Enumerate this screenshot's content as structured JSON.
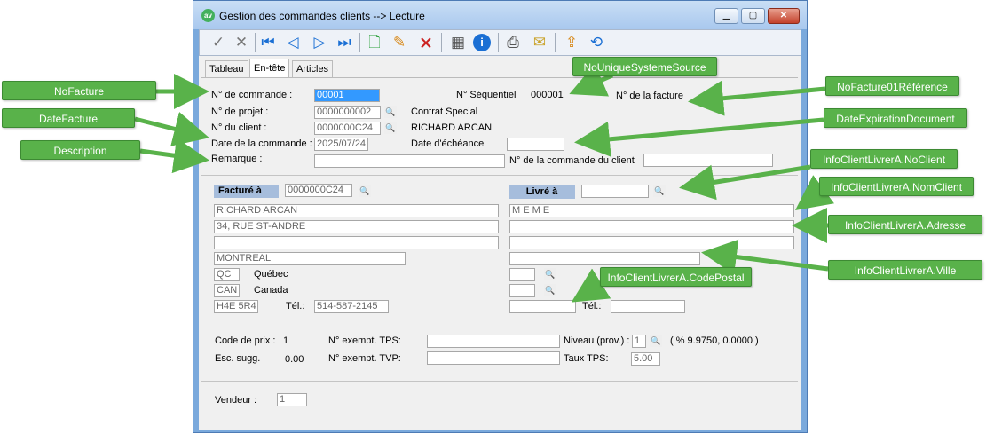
{
  "window": {
    "title": "Gestion des commandes clients  --> Lecture",
    "icon_text": "av",
    "min_label": "▁",
    "max_label": "▢",
    "close_label": "✕"
  },
  "toolbar": {
    "icons": [
      "check-icon",
      "cancel-icon",
      "first-record-icon",
      "previous-record-icon",
      "next-record-icon",
      "last-record-icon",
      "add-document-icon",
      "edit-icon",
      "delete-document-icon",
      "hardware-icon",
      "info-icon",
      "print-icon",
      "email-icon",
      "export-icon",
      "refresh-icon"
    ]
  },
  "tabs": [
    "Tableau",
    "En-tête",
    "Articles"
  ],
  "header": {
    "no_commande_label": "N° de commande :",
    "no_commande_value": "00001",
    "no_projet_label": "N° de projet :",
    "no_projet_value": "0000000002",
    "projet_desc": "Contrat Special",
    "no_client_label": "N° du client :",
    "no_client_value": "0000000C24",
    "client_name": "RICHARD ARCAN",
    "date_commande_label": "Date de la commande :",
    "date_commande_value": "2025/07/24",
    "remarque_label": "Remarque :",
    "remarque_value": "",
    "sequentiel_label": "N° Séquentiel",
    "sequentiel_value": "000001",
    "facture_label": "N° de la facture",
    "echeance_label": "Date d'échéance",
    "echeance_value": "",
    "commande_client_label": "N° de la commande du client",
    "commande_client_value": ""
  },
  "billing": {
    "title": "Facturé à",
    "client_no": "0000000C24",
    "name": "RICHARD ARCAN",
    "address1": "34, RUE ST-ANDRE",
    "address2": "",
    "city": "MONTREAL",
    "province_code": "QC",
    "province_name": "Québec",
    "country_code": "CAN",
    "country_name": "Canada",
    "postal_code": "H4E 5R4",
    "phone_label": "Tél.:",
    "phone": "514-587-2145"
  },
  "shipping": {
    "title": "Livré à",
    "client_no": "",
    "name": "M E M E",
    "address1": "",
    "address2": "",
    "city": "",
    "province_code": "",
    "country_code": "",
    "postal_code": "",
    "phone_label": "Tél.:",
    "phone": ""
  },
  "pricing": {
    "code_prix_label": "Code de prix :",
    "code_prix_value": "1",
    "esc_label": "Esc. sugg.",
    "esc_value": "0.00",
    "tps_label": "N° exempt. TPS:",
    "tvp_label": "N° exempt. TVP:",
    "niveau_label": "Niveau (prov.) :",
    "niveau_value": "1",
    "rates_text": "( %  9.9750,   0.0000 )",
    "taux_tps_label": "Taux TPS:",
    "taux_tps_value": "5.00"
  },
  "vendeur": {
    "label": "Vendeur :",
    "value": "1"
  },
  "callouts": {
    "nofacture": "NoFacture",
    "datefacture": "DateFacture",
    "description": "Description",
    "nounique": "NoUniqueSystemeSource",
    "nofacture01": "NoFacture01Référence",
    "dateexpiration": "DateExpirationDocument",
    "noclient": "InfoClientLivrerA.NoClient",
    "nomclient": "InfoClientLivrerA.NomClient",
    "adresse": "InfoClientLivrerA.Adresse",
    "ville": "InfoClientLivrerA.Ville",
    "codepostal": "InfoClientLivrerA.CodePostal"
  },
  "colors": {
    "callout_green": "#59b24a",
    "selected_field": "#3399ff",
    "section_header": "#a6bddc"
  }
}
